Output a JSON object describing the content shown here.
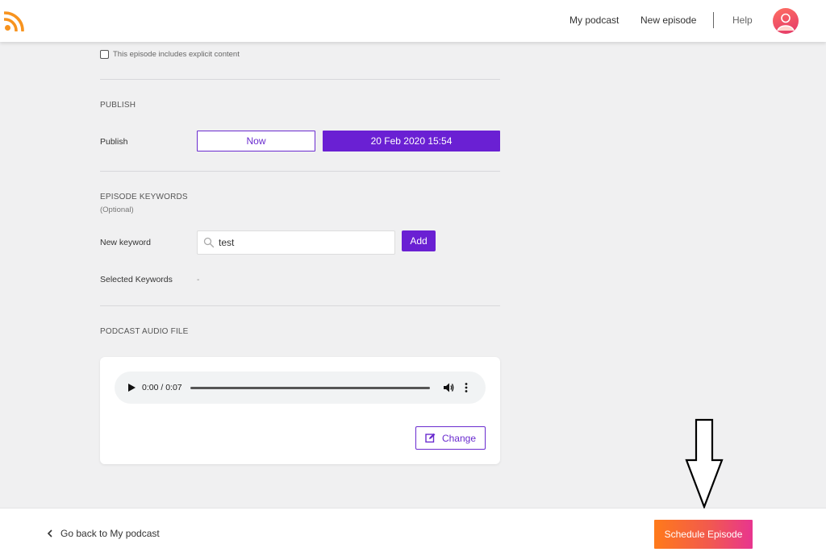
{
  "header": {
    "logo_icon": "rss-icon",
    "nav": {
      "my_podcast": "My podcast",
      "new_episode": "New episode",
      "help": "Help"
    },
    "avatar_icon": "user-avatar-icon"
  },
  "explicit": {
    "label": "This episode includes explicit content",
    "checked": false
  },
  "publish": {
    "section_title": "PUBLISH",
    "label": "Publish",
    "now_label": "Now",
    "date_label": "20 Feb 2020 15:54"
  },
  "keywords": {
    "section_title": "EPISODE KEYWORDS",
    "optional": "(Optional)",
    "new_label": "New keyword",
    "input_value": "test",
    "add_label": "Add",
    "selected_label": "Selected Keywords",
    "selected_value": "-"
  },
  "audio": {
    "section_title": "PODCAST AUDIO FILE",
    "time": "0:00 / 0:07",
    "progress": 0,
    "change_label": "Change"
  },
  "footer": {
    "back_label": "Go back to My podcast",
    "schedule_label": "Schedule Episode"
  },
  "colors": {
    "accent": "#6a20d3",
    "gradient_start": "#ff7a1a",
    "gradient_end": "#e8358f",
    "logo": "#f7931e"
  }
}
